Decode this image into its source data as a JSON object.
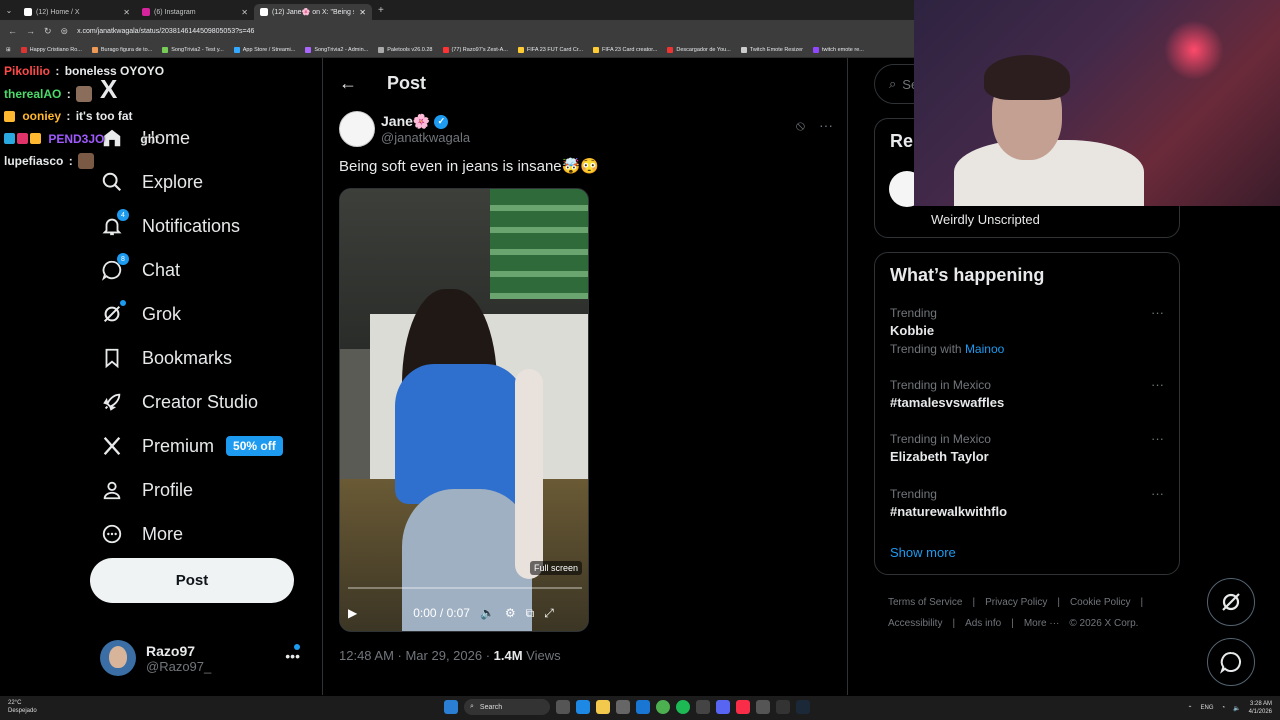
{
  "browser": {
    "tabs": [
      {
        "title": "(12) Home / X",
        "active": false
      },
      {
        "title": "(6) Instagram",
        "active": false
      },
      {
        "title": "(12) Jane🌸 on X: \"Being soft ...",
        "active": true
      }
    ],
    "url": "x.com/janatkwagala/status/2038146144509805053?s=46",
    "bookmarks": [
      "Happy Cristiano Ro...",
      "Burago figura de to...",
      "SongTrivia2 - Test y...",
      "App Store / Streami...",
      "SongTrivia2 - Admin...",
      "Paletools v26.0.28",
      "(77) Razo97's Zest-A...",
      "FIFA 23 FUT Card Cr...",
      "FIFA 23 Card creator...",
      "Descargador de You...",
      "Twitch Emote Resizer",
      "twitch emote re..."
    ]
  },
  "stream_chat": [
    {
      "user": "Pikolilio",
      "color": "#ff4a4a",
      "message": "boneless OYOYO"
    },
    {
      "user": "therealAO",
      "color": "#4ad96a",
      "message": ""
    },
    {
      "user": "ooniey",
      "color": "#ffb830",
      "message": "it's too fat"
    },
    {
      "user": "PEND3JO",
      "color": "#a05aff",
      "message": "ght"
    },
    {
      "user": "lupefiasco",
      "color": "#ffffff",
      "message": ""
    }
  ],
  "sidebar": {
    "logo": "X",
    "items": [
      {
        "label": "Home",
        "icon": "home-icon"
      },
      {
        "label": "Explore",
        "icon": "search-icon"
      },
      {
        "label": "Notifications",
        "icon": "bell-icon",
        "badge": "4"
      },
      {
        "label": "Chat",
        "icon": "chat-icon",
        "badge": "8"
      },
      {
        "label": "Grok",
        "icon": "grok-icon"
      },
      {
        "label": "Bookmarks",
        "icon": "bookmark-icon"
      },
      {
        "label": "Creator Studio",
        "icon": "rocket-icon"
      },
      {
        "label": "Premium",
        "icon": "x-icon",
        "tag": "50% off"
      },
      {
        "label": "Profile",
        "icon": "person-icon"
      },
      {
        "label": "More",
        "icon": "more-circle-icon"
      }
    ],
    "post_button": "Post",
    "account": {
      "name": "Razo97",
      "handle": "@Razo97_"
    }
  },
  "main": {
    "header_title": "Post",
    "tweet": {
      "name": "Jane🌸",
      "handle": "@janatkwagala",
      "text": "Being soft even in jeans is insane🤯😳",
      "video": {
        "time": "0:00 / 0:07",
        "tooltip": "Full screen",
        "progress": 0
      },
      "timestamp": "12:48 AM · Mar 29, 2026 · ",
      "views_count": "1.4M",
      "views_label": " Views"
    }
  },
  "right": {
    "search_placeholder": "Se",
    "relevant_title": "Rel",
    "relevant_bio": "Weirdly Unscripted",
    "happening_title": "What’s happening",
    "trends": [
      {
        "context": "Trending",
        "topic": "Kobbie",
        "with_label": "Trending with ",
        "with_link": "Mainoo"
      },
      {
        "context": "Trending in Mexico",
        "topic": "#tamalesvswaffles"
      },
      {
        "context": "Trending in Mexico",
        "topic": "Elizabeth Taylor"
      },
      {
        "context": "Trending",
        "topic": "#naturewalkwithflo"
      }
    ],
    "show_more": "Show more",
    "footer": [
      "Terms of Service",
      "|",
      "Privacy Policy",
      "|",
      "Cookie Policy",
      "|",
      "Accessibility",
      "|",
      "Ads info",
      "|",
      "More ···",
      "© 2026 X Corp."
    ]
  },
  "taskbar": {
    "temp": "22°C",
    "weather": "Despejado",
    "search": "Search",
    "lang": "ENG",
    "time": "3:28 AM",
    "date": "4/1/2026"
  },
  "colors": {
    "accent": "#1d9bf0",
    "background": "#000000",
    "border": "#2f3336",
    "muted": "#71767b"
  }
}
